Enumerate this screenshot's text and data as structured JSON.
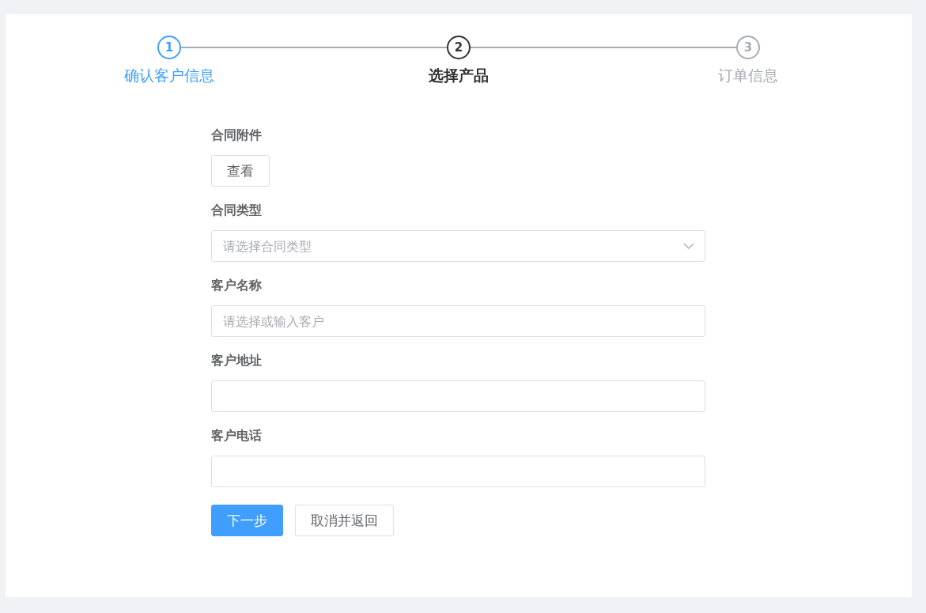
{
  "steps": [
    {
      "number": "1",
      "label": "确认客户信息",
      "kind": "finish"
    },
    {
      "number": "2",
      "label": "选择产品",
      "kind": "process"
    },
    {
      "number": "3",
      "label": "订单信息",
      "kind": "wait"
    }
  ],
  "form": {
    "attachment": {
      "label": "合同附件",
      "button": "查看"
    },
    "fields": [
      {
        "kind": "select",
        "label": "合同类型",
        "placeholder": "请选择合同类型"
      },
      {
        "kind": "input",
        "label": "客户名称",
        "placeholder": "请选择或输入客户"
      },
      {
        "kind": "input",
        "label": "客户地址"
      },
      {
        "kind": "input",
        "label": "客户电话"
      }
    ],
    "actions": [
      {
        "kind": "primary",
        "label": "下一步"
      },
      {
        "kind": "default",
        "label": "取消并返回"
      }
    ]
  }
}
